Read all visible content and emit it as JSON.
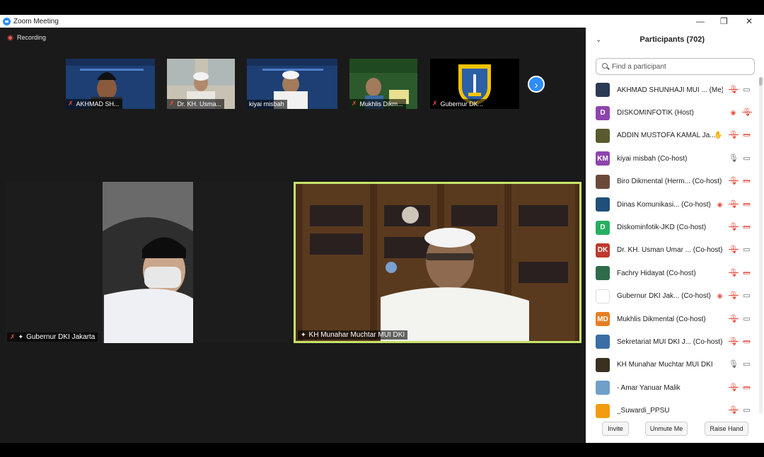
{
  "window": {
    "title": "Zoom Meeting",
    "minimize_glyph": "—",
    "restore_glyph": "❐",
    "close_glyph": "✕"
  },
  "recording": {
    "label": "Recording"
  },
  "gallery": {
    "thumbs": [
      {
        "name": "AKHMAD SH...",
        "muted": true
      },
      {
        "name": "Dr. KH. Usma...",
        "muted": true
      },
      {
        "name": "kiyai misbah",
        "muted": false
      },
      {
        "name": "Mukhlis Dikm...",
        "muted": true
      },
      {
        "name": "Gubernur DK...",
        "muted": true
      }
    ],
    "next_glyph": "›"
  },
  "main_tiles": {
    "left": {
      "name": "Gubernur DKI Jakarta"
    },
    "right": {
      "name": "KH Munahar Muchtar MUI DKI"
    }
  },
  "participants": {
    "title": "Participants (702)",
    "search_placeholder": "Find a participant",
    "list": [
      {
        "name": "AKHMAD SHUNHAJI MUI ...  (Me)",
        "avatar": "",
        "color": "#2b3a55",
        "icons": [
          "mic-muted",
          "video-on"
        ]
      },
      {
        "name": "DISKOMINFOTIK (Host)",
        "avatar": "D",
        "color": "#8e44ad",
        "icons": [
          "recording",
          "mic-muted"
        ]
      },
      {
        "name": "ADDIN MUSTOFA KAMAL Ja...",
        "avatar": "",
        "color": "#5a5a30",
        "icons": [
          "raise-hand",
          "mic-muted",
          "video-muted"
        ]
      },
      {
        "name": "kiyai misbah (Co-host)",
        "avatar": "KM",
        "color": "#8e44ad",
        "icons": [
          "mic-on",
          "video-on"
        ]
      },
      {
        "name": "Biro Dikmental (Herm...  (Co-host)",
        "avatar": "",
        "color": "#6b4a3a",
        "icons": [
          "mic-muted",
          "video-muted"
        ]
      },
      {
        "name": "Dinas Komunikasi...  (Co-host)",
        "avatar": "",
        "color": "#1f4f7a",
        "icons": [
          "recording",
          "mic-muted",
          "video-muted"
        ]
      },
      {
        "name": "Diskominfotik-JKD (Co-host)",
        "avatar": "D",
        "color": "#27ae60",
        "icons": [
          "mic-muted",
          "video-muted"
        ]
      },
      {
        "name": "Dr. KH. Usman Umar ...  (Co-host)",
        "avatar": "DK",
        "color": "#c0392b",
        "icons": [
          "mic-muted",
          "video-on"
        ]
      },
      {
        "name": "Fachry Hidayat (Co-host)",
        "avatar": "",
        "color": "#2e6b4a",
        "icons": [
          "mic-muted",
          "video-muted"
        ]
      },
      {
        "name": "Gubernur DKI Jak...  (Co-host)",
        "avatar": "",
        "color": "#ffffff",
        "icons": [
          "recording",
          "mic-muted",
          "video-on"
        ]
      },
      {
        "name": "Mukhlis Dikmental (Co-host)",
        "avatar": "MD",
        "color": "#e67e22",
        "icons": [
          "mic-muted",
          "video-on"
        ]
      },
      {
        "name": "Sekretariat MUI DKI J...  (Co-host)",
        "avatar": "",
        "color": "#3a6ea5",
        "icons": [
          "mic-muted",
          "video-muted"
        ]
      },
      {
        "name": "KH Munahar Muchtar MUI DKI",
        "avatar": "",
        "color": "#3a3020",
        "icons": [
          "mic-on",
          "video-on"
        ]
      },
      {
        "name": "- Amar Yanuar Malik",
        "avatar": "",
        "color": "#6fa0c8",
        "icons": [
          "mic-muted",
          "video-muted"
        ]
      },
      {
        "name": "_Suwardi_PPSU",
        "avatar": "",
        "color": "#f39c12",
        "icons": [
          "mic-muted",
          "video-on"
        ]
      }
    ],
    "buttons": {
      "invite": "Invite",
      "unmute": "Unmute Me",
      "raise_hand": "Raise Hand"
    }
  },
  "icon_glyphs": {
    "mic-muted": "🎙",
    "mic-on": "🎙",
    "video-on": "▭",
    "video-muted": "▭",
    "recording": "◉",
    "raise-hand": "✋"
  }
}
